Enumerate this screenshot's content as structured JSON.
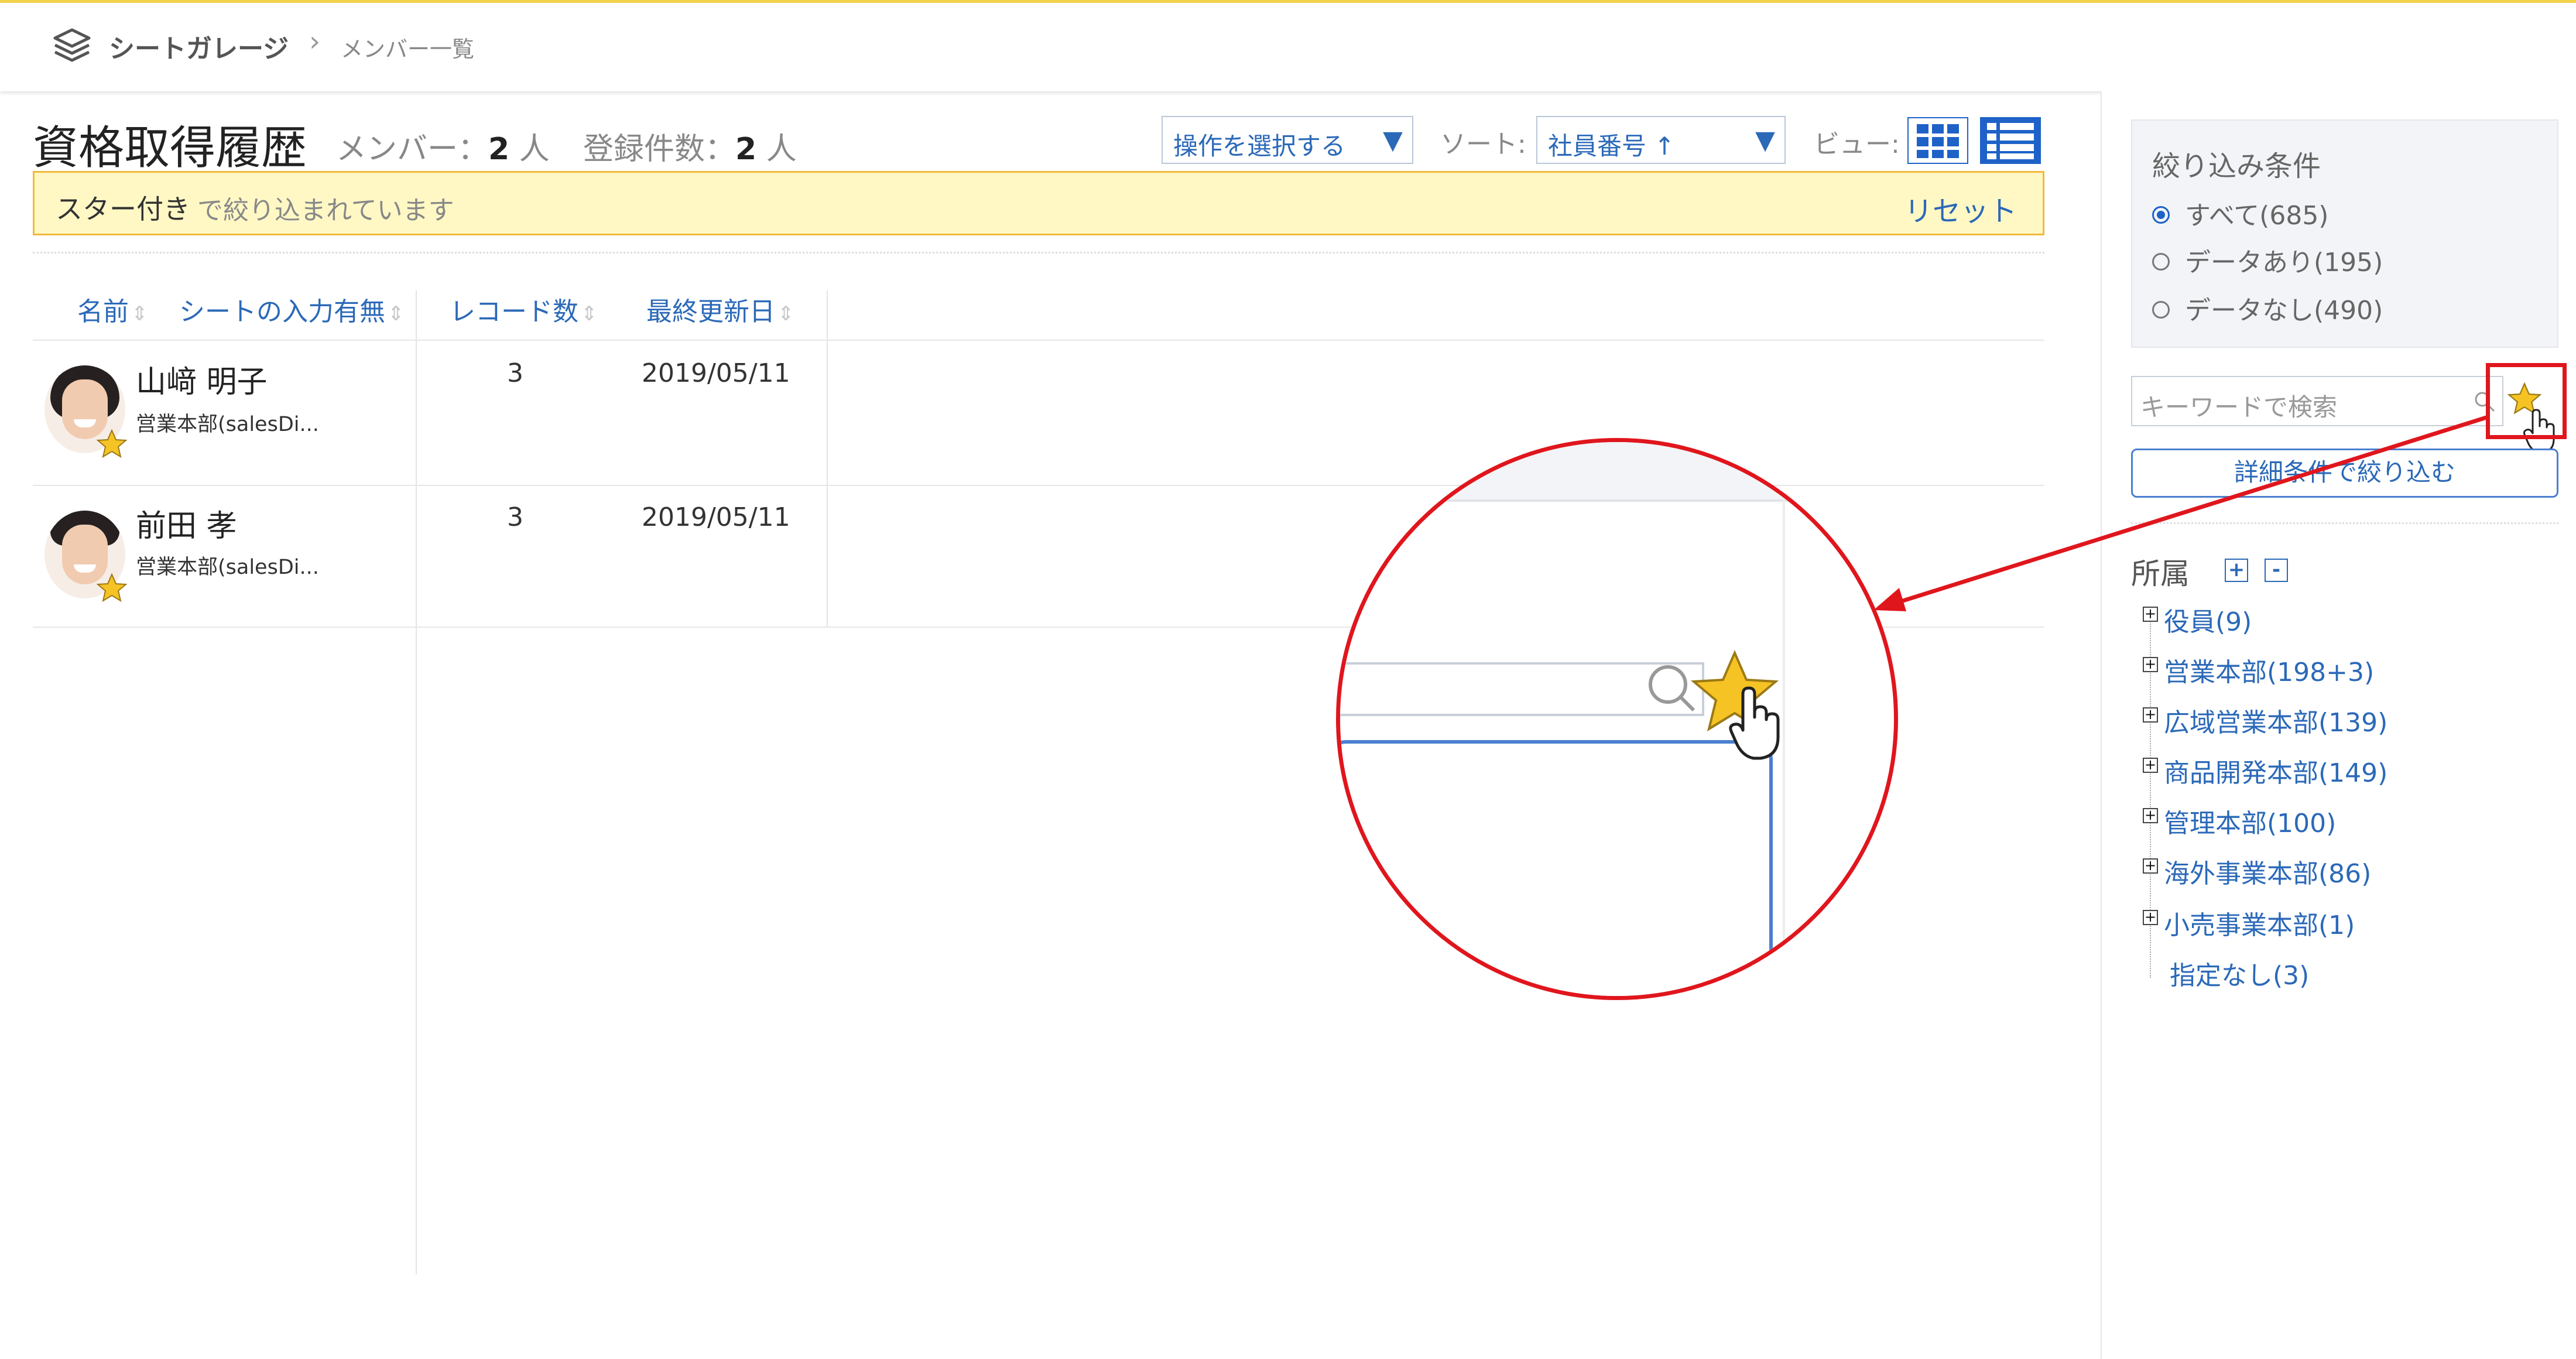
{
  "header": {
    "app_name": "シートガレージ",
    "breadcrumb_sep": "›",
    "breadcrumb": "メンバー一覧",
    "accent_color": "#f2d24d"
  },
  "page": {
    "title": "資格取得履歴",
    "member_label": "メンバー：",
    "member_count": "2",
    "member_unit": "人",
    "registered_label": "登録件数：",
    "registered_count": "2",
    "registered_unit": "人"
  },
  "toolbar": {
    "operation_select": "操作を選択する",
    "sort_label": "ソート:",
    "sort_select": "社員番号 ↑",
    "view_label": "ビュー:",
    "view_modes": [
      "grid-view-icon",
      "list-view-icon"
    ],
    "active_view": "list"
  },
  "filter_banner": {
    "filter_name": "スター付き",
    "message": "で絞り込まれています",
    "reset_label": "リセット"
  },
  "table": {
    "columns": [
      "名前",
      "シートの入力有無",
      "レコード数",
      "最終更新日"
    ],
    "sort_icon": "⇕",
    "rows": [
      {
        "name": "山﨑 明子",
        "dept": "営業本部(salesDi...",
        "records": "3",
        "updated": "2019/05/11",
        "starred": true
      },
      {
        "name": "前田 孝",
        "dept": "営業本部(salesDi...",
        "records": "3",
        "updated": "2019/05/11",
        "starred": true
      }
    ]
  },
  "sidebar": {
    "filter_title": "絞り込み条件",
    "filter_options": [
      {
        "label": "すべて(685)",
        "selected": true
      },
      {
        "label": "データあり(195)",
        "selected": false
      },
      {
        "label": "データなし(490)",
        "selected": false
      }
    ],
    "search_placeholder": "キーワードで検索",
    "star_filter_icon": "star-icon",
    "detail_button": "詳細条件で絞り込む",
    "affiliation_title": "所属",
    "expand_label": "+",
    "collapse_label": "-",
    "tree": [
      {
        "label": "役員(9)",
        "expandable": true
      },
      {
        "label": "営業本部(198+3)",
        "expandable": true
      },
      {
        "label": "広域営業本部(139)",
        "expandable": true
      },
      {
        "label": "商品開発本部(149)",
        "expandable": true
      },
      {
        "label": "管理本部(100)",
        "expandable": true
      },
      {
        "label": "海外事業本部(86)",
        "expandable": true
      },
      {
        "label": "小売事業本部(1)",
        "expandable": true
      },
      {
        "label": "指定なし(3)",
        "expandable": false
      }
    ]
  },
  "annotation": {
    "highlight_color": "#e0161d"
  }
}
